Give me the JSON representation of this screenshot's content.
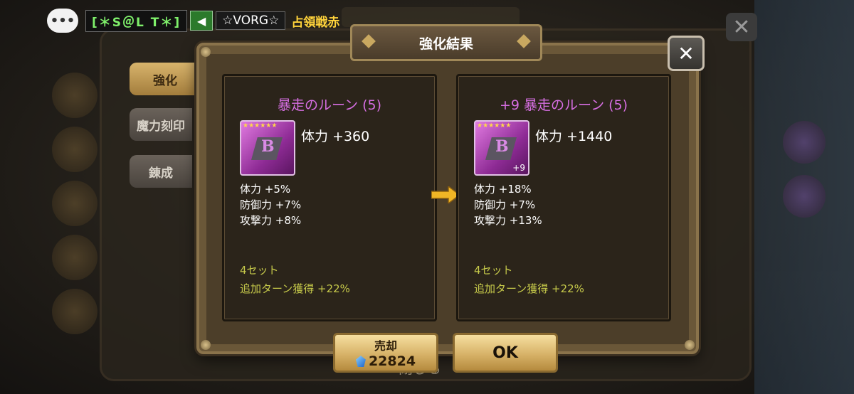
{
  "topbar": {
    "chat_icon": "chat-bubble-icon",
    "guild_tag": "[＊S＠L T＊]",
    "megaphone_icon": "megaphone-icon",
    "player_tag": "☆VORG☆",
    "occupy_text": "占領戦赤"
  },
  "side_tabs": [
    "強化",
    "魔力刻印",
    "錬成"
  ],
  "dialog": {
    "title": "強化結果",
    "close_label": "✕"
  },
  "before": {
    "name": "暴走のルーン (5)",
    "main_stat": "体力 +360",
    "subs": [
      "体力 +5%",
      "防御力 +7%",
      "攻撃力 +8%"
    ],
    "set_count": "4セット",
    "set_effect": "追加ターン獲得 +22%",
    "stars": "★★★★★★",
    "letter": "B",
    "level_badge": ""
  },
  "after": {
    "name": "+9 暴走のルーン (5)",
    "main_stat": "体力 +1440",
    "subs": [
      "体力 +18%",
      "防御力 +7%",
      "攻撃力 +13%"
    ],
    "set_count": "4セット",
    "set_effect": "追加ターン獲得 +22%",
    "stars": "★★★★★★",
    "letter": "B",
    "level_badge": "+9"
  },
  "buttons": {
    "sell_label": "売却",
    "sell_price": "22824",
    "ok_label": "OK"
  },
  "background": {
    "close_label": "閉じる"
  },
  "colors": {
    "rune_name": "#d66ee2",
    "set_text": "#c6c94a",
    "guild_text": "#7ff06b",
    "occupy_text": "#ffd33b",
    "button_gold": "#d7b268"
  }
}
